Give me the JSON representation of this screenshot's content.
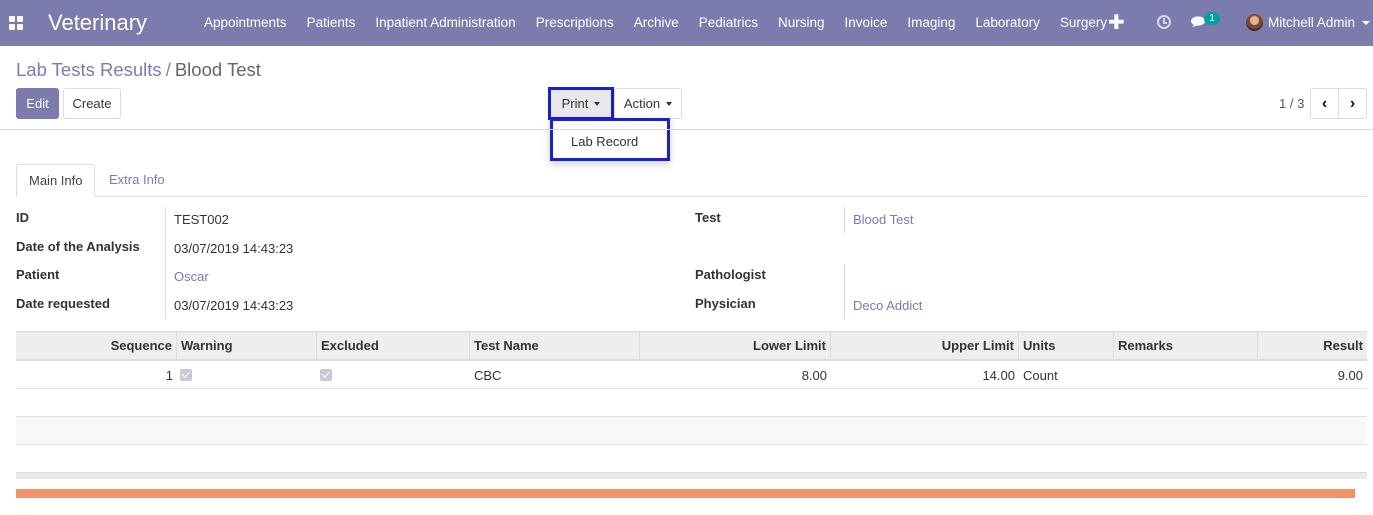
{
  "navbar": {
    "brand": "Veterinary",
    "menu": [
      "Appointments",
      "Patients",
      "Inpatient Administration",
      "Prescriptions",
      "Archive",
      "Pediatrics",
      "Nursing",
      "Invoice",
      "Imaging",
      "Laboratory",
      "Surgery"
    ],
    "chat_count": "1",
    "user_name": "Mitchell Admin"
  },
  "breadcrumb": {
    "parent": "Lab Tests Results",
    "separator": "/",
    "current": "Blood Test"
  },
  "buttons": {
    "edit": "Edit",
    "create": "Create",
    "print": "Print",
    "action": "Action"
  },
  "print_menu": {
    "items": [
      "Lab Record"
    ]
  },
  "pager": {
    "value": "1 / 3"
  },
  "tabs": [
    "Main Info",
    "Extra Info"
  ],
  "fields": {
    "id_label": "ID",
    "id_value": "TEST002",
    "date_analysis_label": "Date of the Analysis",
    "date_analysis_value": "03/07/2019 14:43:23",
    "patient_label": "Patient",
    "patient_value": "Oscar",
    "date_requested_label": "Date requested",
    "date_requested_value": "03/07/2019 14:43:23",
    "test_label": "Test",
    "test_value": "Blood Test",
    "pathologist_label": "Pathologist",
    "pathologist_value": "",
    "physician_label": "Physician",
    "physician_value": "Deco Addict"
  },
  "table": {
    "columns": [
      "Sequence",
      "Warning",
      "Excluded",
      "Test Name",
      "Lower Limit",
      "Upper Limit",
      "Units",
      "Remarks",
      "Result"
    ],
    "rows": [
      {
        "sequence": "1",
        "warning": true,
        "excluded": true,
        "test_name": "CBC",
        "lower_limit": "8.00",
        "upper_limit": "14.00",
        "units": "Count",
        "remarks": "",
        "result": "9.00"
      }
    ]
  },
  "colors": {
    "navbar": "#7c7bad",
    "link": "#7c7bad",
    "highlight": "#1a1fd6",
    "bottom_bar": "#f0936b"
  }
}
